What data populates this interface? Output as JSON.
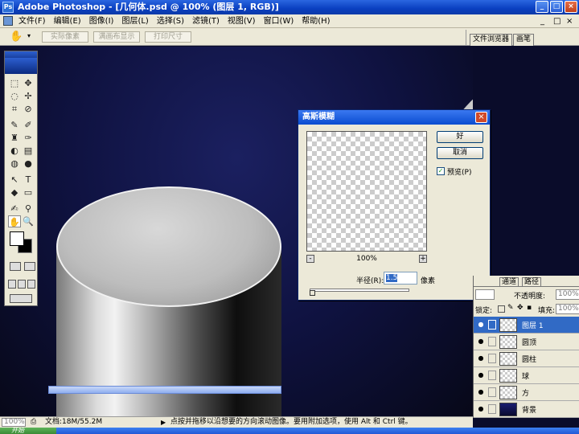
{
  "window": {
    "title": "Adobe Photoshop - [几何体.psd @ 100% (图层 1, RGB)]",
    "controls": [
      "_",
      "□",
      "×"
    ]
  },
  "menu": {
    "items": [
      "文件(F)",
      "编辑(E)",
      "图像(I)",
      "图层(L)",
      "选择(S)",
      "滤镜(T)",
      "视图(V)",
      "窗口(W)",
      "帮助(H)"
    ],
    "doc_controls": [
      "_",
      "□",
      "×"
    ]
  },
  "options": {
    "buttons": [
      "实际像素",
      "满画布显示",
      "打印尺寸"
    ],
    "palette_tabs": [
      "文件浏览器",
      "画笔"
    ]
  },
  "tools": {
    "glyphs": [
      "⬚",
      "✥",
      "◌",
      "✢",
      "⌗",
      "⊘",
      "✎",
      "✐",
      "♜",
      "✑",
      "◐",
      "▤",
      "◍",
      "●",
      "↖",
      "T",
      "◆",
      "▭",
      "✍",
      "⚲",
      "✋",
      "🔍"
    ]
  },
  "dialog": {
    "title": "高斯模糊",
    "ok": "好",
    "cancel": "取消",
    "preview_label": "预览(P)",
    "preview_checked": "✓",
    "zoom_minus": "-",
    "zoom_plus": "+",
    "zoom": "100%",
    "radius_label": "半径(R):",
    "radius_value": "1.5",
    "radius_unit": "像素",
    "close": "×"
  },
  "layers": {
    "tabs": [
      "通道",
      "路径"
    ],
    "opacity_label": "不透明度:",
    "opacity_value": "100%",
    "lock_label": "锁定:",
    "fill_label": "填充:",
    "fill_value": "100%",
    "items": [
      {
        "name": "图层 1",
        "selected": true
      },
      {
        "name": "圆顶",
        "selected": false
      },
      {
        "name": "圆柱",
        "selected": false
      },
      {
        "name": "球",
        "selected": false
      },
      {
        "name": "方",
        "selected": false
      },
      {
        "name": "背景",
        "selected": false
      }
    ]
  },
  "status": {
    "zoom": "100%",
    "doc_info": "文档:18M/55.2M",
    "hint": "点按并拖移以沿想要的方向滚动图像。要用附加选项，使用 Alt 和 Ctrl 键。"
  },
  "taskbar": {
    "start": "开始"
  }
}
